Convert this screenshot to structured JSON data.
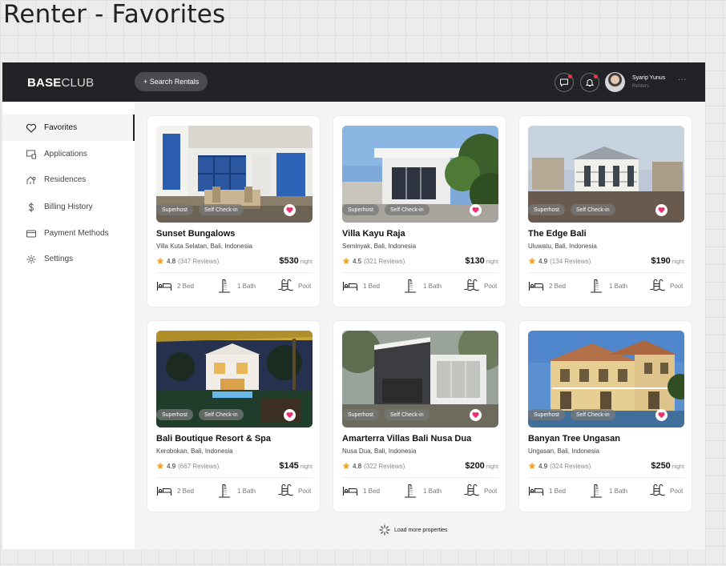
{
  "page_title": "Renter - Favorites",
  "header": {
    "logo_bold": "BASE",
    "logo_light": "CLUB",
    "search_label": "+ Search Rentals",
    "user_name": "Syarip Yunus",
    "user_role": "Renters",
    "more_label": "..."
  },
  "sidebar": {
    "items": [
      {
        "label": "Favorites",
        "icon": "heart-icon",
        "active": true
      },
      {
        "label": "Applications",
        "icon": "applications-icon"
      },
      {
        "label": "Residences",
        "icon": "residences-icon"
      },
      {
        "label": "Billing History",
        "icon": "dollar-icon"
      },
      {
        "label": "Payment Methods",
        "icon": "card-icon"
      },
      {
        "label": "Settings",
        "icon": "gear-icon"
      }
    ]
  },
  "tags": {
    "superhost": "Superhost",
    "self_checkin": "Self Check-in"
  },
  "properties": [
    {
      "name": "Sunset Bungalows",
      "location": "Villa Kuta Selatan, Bali, Indonesia",
      "rating": "4.8",
      "reviews": "(347 Reviews)",
      "price": "$530",
      "unit": "night",
      "beds": "2 Bed",
      "baths": "1 Bath",
      "pool": "Pool"
    },
    {
      "name": "Villa Kayu Raja",
      "location": "Seminyak, Bali, Indonesia",
      "rating": "4.5",
      "reviews": "(321 Reviews)",
      "price": "$130",
      "unit": "night",
      "beds": "1 Bed",
      "baths": "1 Bath",
      "pool": "Pool"
    },
    {
      "name": "The Edge Bali",
      "location": "Uluwatu, Bali, Indonesia",
      "rating": "4.9",
      "reviews": "(134 Reviews)",
      "price": "$190",
      "unit": "night",
      "beds": "2 Bed",
      "baths": "1 Bath",
      "pool": "Pool"
    },
    {
      "name": "Bali Boutique Resort & Spa",
      "location": "Kerobokan, Bali, Indonesia",
      "rating": "4.9",
      "reviews": "(667 Reviews)",
      "price": "$145",
      "unit": "night",
      "beds": "2 Bed",
      "baths": "1 Bath",
      "pool": "Pool"
    },
    {
      "name": "Amarterra Villas Bali Nusa Dua",
      "location": "Nusa Dua, Bali, Indonesia",
      "rating": "4.8",
      "reviews": "(322 Reviews)",
      "price": "$200",
      "unit": "night",
      "beds": "1 Bed",
      "baths": "1 Bath",
      "pool": "Pool"
    },
    {
      "name": "Banyan Tree Ungasan",
      "location": "Ungasan, Bali, Indonesia",
      "rating": "4.9",
      "reviews": "(324 Reviews)",
      "price": "$250",
      "unit": "night",
      "beds": "1 Bed",
      "baths": "1 Bath",
      "pool": "Pool"
    }
  ],
  "load_more": "Load more properties",
  "colors": {
    "accent": "#e8336b",
    "header_bg": "#222326",
    "star": "#f5a623"
  }
}
